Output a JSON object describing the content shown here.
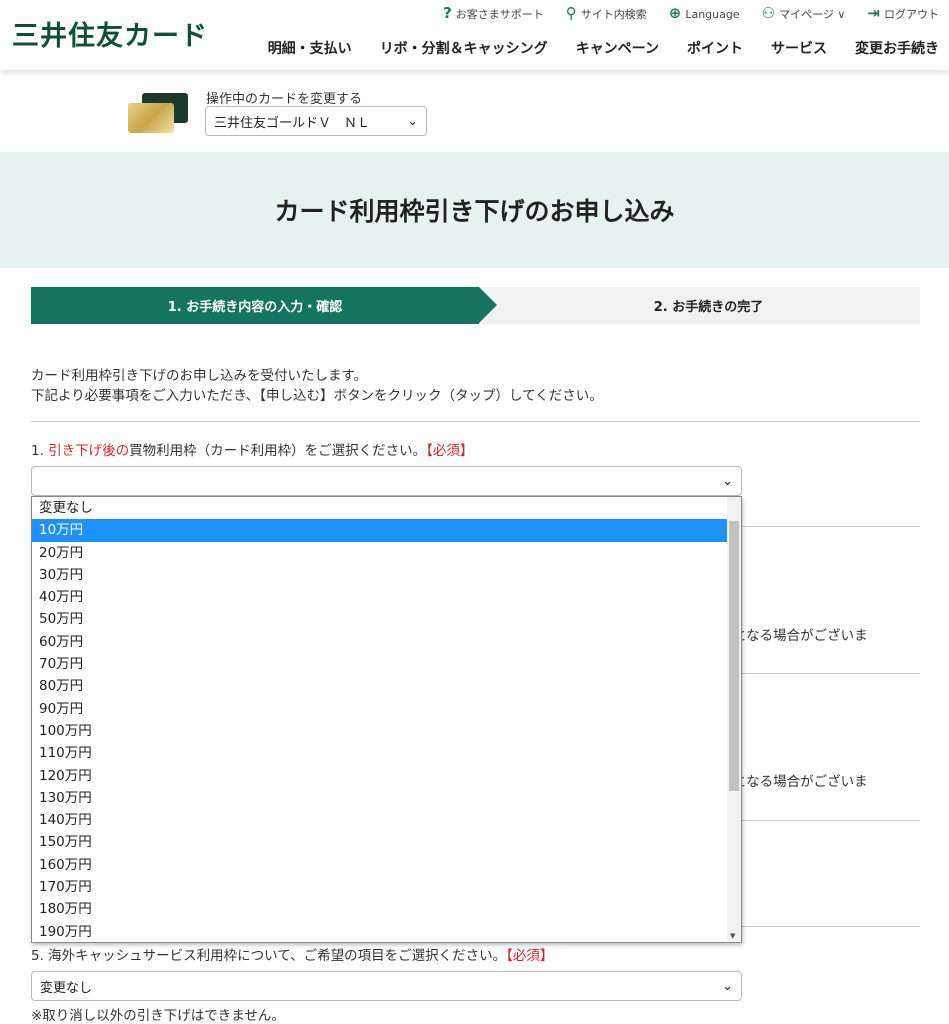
{
  "header": {
    "logo": "三井住友カード",
    "util": [
      {
        "icon": "question-icon",
        "glyph": "?",
        "label": "お客さまサポート"
      },
      {
        "icon": "search-icon",
        "glyph": "⚲",
        "label": "サイト内検索"
      },
      {
        "icon": "globe-icon",
        "glyph": "⊕",
        "label": "Language"
      },
      {
        "icon": "user-icon",
        "glyph": "⚇",
        "label": "マイページ ∨"
      },
      {
        "icon": "logout-icon",
        "glyph": "⇥",
        "label": "ログアウト"
      }
    ],
    "nav": [
      "明細・支払い",
      "リボ・分割＆キャッシング",
      "キャンペーン",
      "ポイント",
      "サービス",
      "変更お手続き"
    ]
  },
  "card": {
    "label": "操作中のカードを変更する",
    "selected": "三井住友ゴールドＶ　ＮＬ"
  },
  "page_title": "カード利用枠引き下げのお申し込み",
  "steps": [
    "1. お手続き内容の入力・確認",
    "2. お手続きの完了"
  ],
  "intro": [
    "カード利用枠引き下げのお申し込みを受付いたします。",
    "下記より必要事項をご入力いただき、【申し込む】ボタンをクリック（タップ）してください。"
  ],
  "q1": {
    "num": "1. ",
    "red": "引き下げ後の",
    "rest": "買物利用枠（カード利用枠）をご選択ください。",
    "required": "【必須】",
    "value": ""
  },
  "hidden_text": [
    "となる場合がございま",
    "となる場合がございま"
  ],
  "dropdown": {
    "options": [
      "変更なし",
      "10万円",
      "20万円",
      "30万円",
      "40万円",
      "50万円",
      "60万円",
      "70万円",
      "80万円",
      "90万円",
      "100万円",
      "110万円",
      "120万円",
      "130万円",
      "140万円",
      "150万円",
      "160万円",
      "170万円",
      "180万円",
      "190万円"
    ],
    "highlighted": 1,
    "highlight_color": "#1e90ff"
  },
  "q5": {
    "text": "5. 海外キャッシュサービス利用枠について、ご希望の項目をご選択ください。",
    "required": "【必須】",
    "value": "変更なし",
    "note": "※取り消し以外の引き下げはできません。"
  },
  "colors": {
    "brand": "#147460",
    "banner": "#e6f2ef",
    "required": "#d0262b"
  }
}
